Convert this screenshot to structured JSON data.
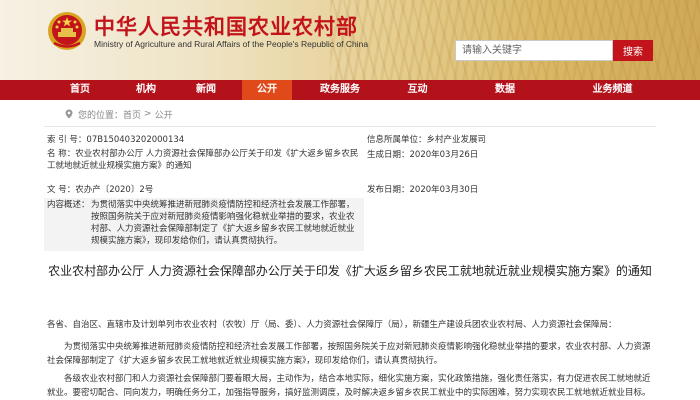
{
  "header": {
    "title": "中华人民共和国农业农村部",
    "subtitle": "Ministry of Agriculture and Rural Affairs of the People's Republic of China",
    "emblem_icon": "national-emblem-icon"
  },
  "search": {
    "placeholder": "请输入关键字",
    "button_label": "搜索"
  },
  "nav": {
    "items": [
      {
        "label": "首页"
      },
      {
        "label": "机构"
      },
      {
        "label": "新闻"
      },
      {
        "label": "公开"
      },
      {
        "label": "政务服务"
      },
      {
        "label": "互动"
      },
      {
        "label": "数据"
      },
      {
        "label": "业务频道"
      }
    ],
    "active_index": 3
  },
  "breadcrumb": {
    "label": "您的位置：",
    "home": "首页",
    "separator": ">",
    "current": "公开"
  },
  "meta": {
    "index_label": "索 引 号：",
    "index_value": "07B150403202000134",
    "category_label": "信息所属单位：",
    "category_value": "乡村产业发展司",
    "name_label": "名 称：",
    "name_value": "农业农村部办公厅 人力资源社会保障部办公厅关于印发《扩大返乡留乡农民工就地就近就业规模实施方案》的通知",
    "gen_date_label": "生成日期：",
    "gen_date_value": "2020年03月26日",
    "doc_no_label": "文 号：",
    "doc_no_value": "农办产〔2020〕2号",
    "pub_date_label": "发布日期：",
    "pub_date_value": "2020年03月30日",
    "abstract_label": "内容概述：",
    "abstract_value": "为贯彻落实中央统筹推进新冠肺炎疫情防控和经济社会发展工作部署，按照国务院关于应对新冠肺炎疫情影响强化稳就业举措的要求，农业农村部、人力资源社会保障部制定了《扩大返乡留乡农民工就地就近就业规模实施方案》，现印发给你们，请认真贯彻执行。"
  },
  "article": {
    "title": "农业农村部办公厅 人力资源社会保障部办公厅关于印发《扩大返乡留乡农民工就地就近就业规模实施方案》的通知",
    "addressee": "各省、自治区、直辖市及计划单列市农业农村（农牧）厅（局、委）、人力资源社会保障厅（局），新疆生产建设兵团农业农村局、人力资源社会保障局：",
    "para1": "为贯彻落实中央统筹推进新冠肺炎疫情防控和经济社会发展工作部署，按照国务院关于应对新冠肺炎疫情影响强化稳就业举措的要求，农业农村部、人力资源社会保障部制定了《扩大返乡留乡农民工就地就近就业规模实施方案》，现印发给你们，请认真贯彻执行。",
    "para2": "各级农业农村部门和人力资源社会保障部门要着眼大局，主动作为，结合本地实际，细化实施方案，实化政策措施，强化责任落实，有力促进农民工就地就近就业。要密切配合、同向发力，明确任务分工，加强指导服务，搞好监测调度，及时解决返乡留乡农民工就业中的实际困难，努力实现农民工就地就近就业目标。"
  },
  "colors": {
    "brand_red": "#c4141b",
    "nav_red": "#b3121b",
    "nav_active": "#e04a1a"
  }
}
